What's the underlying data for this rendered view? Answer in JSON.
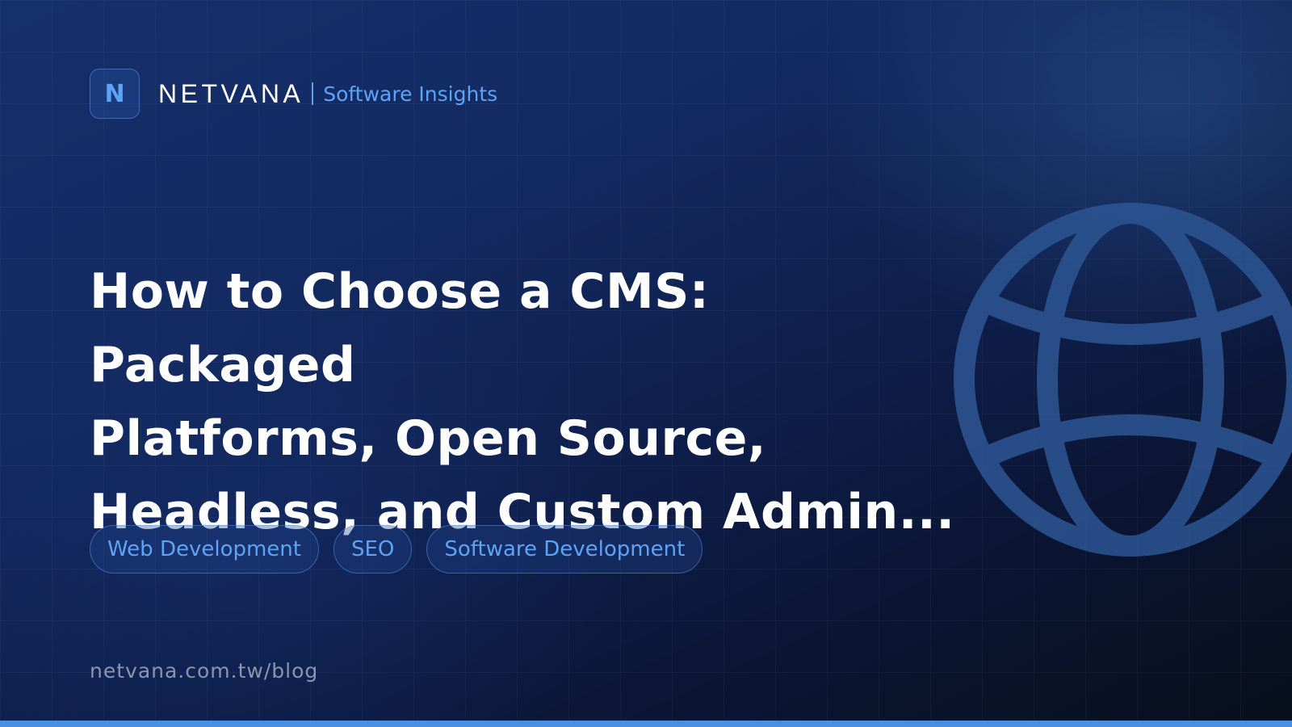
{
  "brand": {
    "logo_letter": "N",
    "name": "NETVANA",
    "tagline": "Software Insights"
  },
  "headline": {
    "line1": "How to Choose a CMS: Packaged",
    "line2": "Platforms, Open Source,",
    "line3": "Headless, and Custom Admin..."
  },
  "tags": [
    "Web Development",
    "SEO",
    "Software Development"
  ],
  "footer": {
    "url": "netvana.com.tw/blog"
  },
  "decoration": {
    "globe_icon": "globe-icon"
  },
  "colors": {
    "accent": "#5ea3f5",
    "bottom_bar": "#4a90e2",
    "background_dark": "#0b1430",
    "background_light": "#16306a"
  }
}
